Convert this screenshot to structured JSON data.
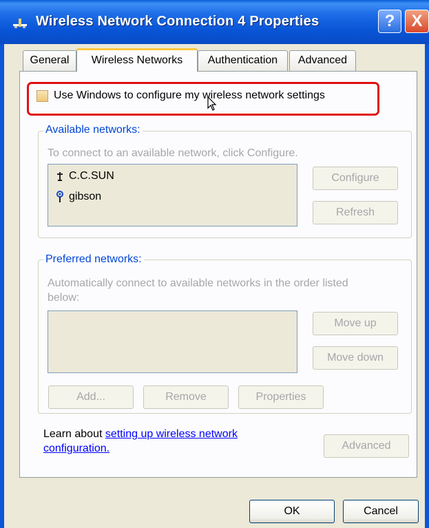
{
  "window": {
    "title": "Wireless Network Connection 4 Properties",
    "help_glyph": "?",
    "close_glyph": "X"
  },
  "tabs": [
    {
      "label": "General",
      "active": false
    },
    {
      "label": "Wireless Networks",
      "active": true
    },
    {
      "label": "Authentication",
      "active": false
    },
    {
      "label": "Advanced",
      "active": false
    }
  ],
  "wireless": {
    "use_windows_label": "Use Windows to configure my wireless network settings",
    "use_windows_checked": false
  },
  "available": {
    "legend": "Available networks:",
    "hint": "To connect to an available network, click Configure.",
    "networks": [
      {
        "name": "C.C.SUN",
        "icon": "network-signal-icon"
      },
      {
        "name": "gibson",
        "icon": "network-antenna-icon"
      }
    ],
    "configure_label": "Configure",
    "refresh_label": "Refresh"
  },
  "preferred": {
    "legend": "Preferred networks:",
    "hint_line1": "Automatically connect to available networks in the order listed",
    "hint_line2": "below:",
    "move_up_label": "Move up",
    "move_down_label": "Move down",
    "add_label": "Add...",
    "remove_label": "Remove",
    "properties_label": "Properties"
  },
  "learn": {
    "prefix": "Learn about ",
    "link_line1": "setting up wireless network",
    "link_line2": "configuration.",
    "advanced_label": "Advanced"
  },
  "footer": {
    "ok_label": "OK",
    "cancel_label": "Cancel"
  },
  "colors": {
    "titlebar": "#0854d6",
    "highlight": "#e01010",
    "legend": "#0046d5",
    "link": "#0000ff",
    "disabled_text": "#a7a6aa"
  }
}
